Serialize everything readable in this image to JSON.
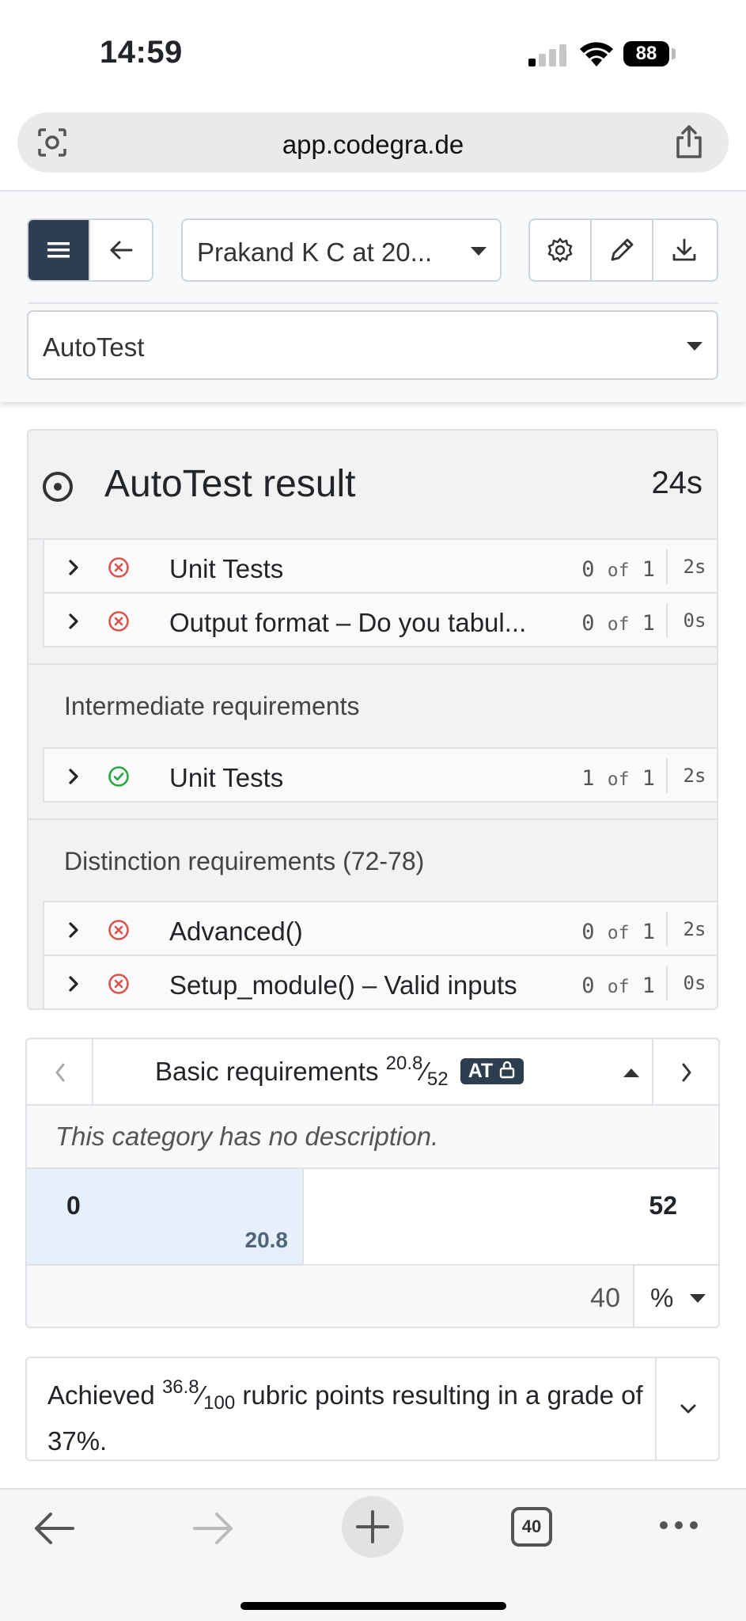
{
  "status_bar": {
    "time": "14:59",
    "battery": "88"
  },
  "browser": {
    "url": "app.codegra.de",
    "tab_count": "40"
  },
  "toolbar": {
    "student_select": "Prakand K C at 20...",
    "mode_select": "AutoTest"
  },
  "autotest": {
    "title": "AutoTest result",
    "duration": "24s",
    "basic_tests": [
      {
        "name": "Unit Tests",
        "achieved": "0",
        "of": "of",
        "total": "1",
        "duration": "2s",
        "status": "fail"
      },
      {
        "name": "Output format – Do you tabul...",
        "achieved": "0",
        "of": "of",
        "total": "1",
        "duration": "0s",
        "status": "fail"
      }
    ],
    "intermediate_label": "Intermediate requirements",
    "intermediate_tests": [
      {
        "name": "Unit Tests",
        "achieved": "1",
        "of": "of",
        "total": "1",
        "duration": "2s",
        "status": "pass"
      }
    ],
    "distinction_label": "Distinction requirements (72-78)",
    "distinction_tests": [
      {
        "name": "Advanced()",
        "achieved": "0",
        "of": "of",
        "total": "1",
        "duration": "2s",
        "status": "fail"
      },
      {
        "name": "Setup_module() – Valid inputs",
        "achieved": "0",
        "of": "of",
        "total": "1",
        "duration": "0s",
        "status": "fail"
      }
    ]
  },
  "rubric": {
    "category": "Basic requirements",
    "score": "20.8",
    "max": "52",
    "badge": "AT",
    "description": "This category has no description.",
    "level_min": "0",
    "level_min_achieved": "20.8",
    "level_max": "52",
    "input_value": "40",
    "unit": "%"
  },
  "summary": {
    "prefix": "Achieved",
    "points": "36.8",
    "total": "100",
    "suffix": "rubric points resulting in a grade of 37%."
  },
  "colors": {
    "brand_dark": "#2c3e50",
    "fail": "#d9534f",
    "pass": "#28a745",
    "selected_level": "#e6f0fb"
  }
}
